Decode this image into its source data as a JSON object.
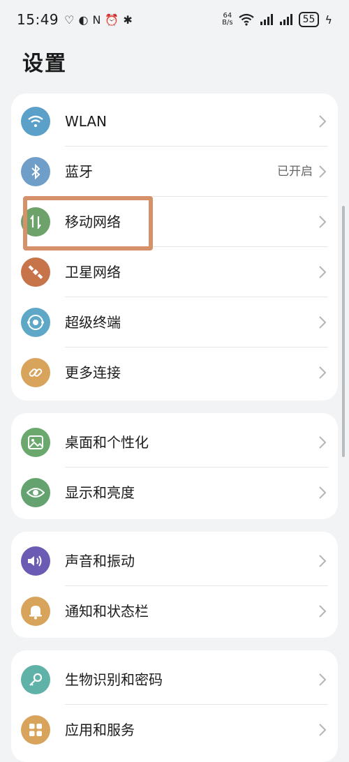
{
  "status_bar": {
    "time": "15:49",
    "speed_value": "64",
    "speed_unit": "B/s",
    "battery": "55"
  },
  "page_title": "设置",
  "groups": [
    {
      "items": [
        {
          "label": "WLAN",
          "icon": "wifi-icon",
          "color": "#5aa0c8"
        },
        {
          "label": "蓝牙",
          "icon": "bluetooth-icon",
          "color": "#6f9ec9",
          "value": "已开启"
        },
        {
          "label": "移动网络",
          "icon": "mobile-data-icon",
          "color": "#6da26b"
        },
        {
          "label": "卫星网络",
          "icon": "satellite-icon",
          "color": "#c8744b"
        },
        {
          "label": "超级终端",
          "icon": "super-device-icon",
          "color": "#5ea7c7"
        },
        {
          "label": "更多连接",
          "icon": "link-icon",
          "color": "#d8a45c"
        }
      ]
    },
    {
      "items": [
        {
          "label": "桌面和个性化",
          "icon": "image-icon",
          "color": "#6aa86e"
        },
        {
          "label": "显示和亮度",
          "icon": "eye-icon",
          "color": "#64a36f"
        }
      ]
    },
    {
      "items": [
        {
          "label": "声音和振动",
          "icon": "speaker-icon",
          "color": "#6b5bb2"
        },
        {
          "label": "通知和状态栏",
          "icon": "bell-icon",
          "color": "#d8a45c"
        }
      ]
    },
    {
      "items": [
        {
          "label": "生物识别和密码",
          "icon": "key-icon",
          "color": "#5fb2a7"
        },
        {
          "label": "应用和服务",
          "icon": "apps-grid-icon",
          "color": "#d8a45c"
        }
      ]
    }
  ]
}
